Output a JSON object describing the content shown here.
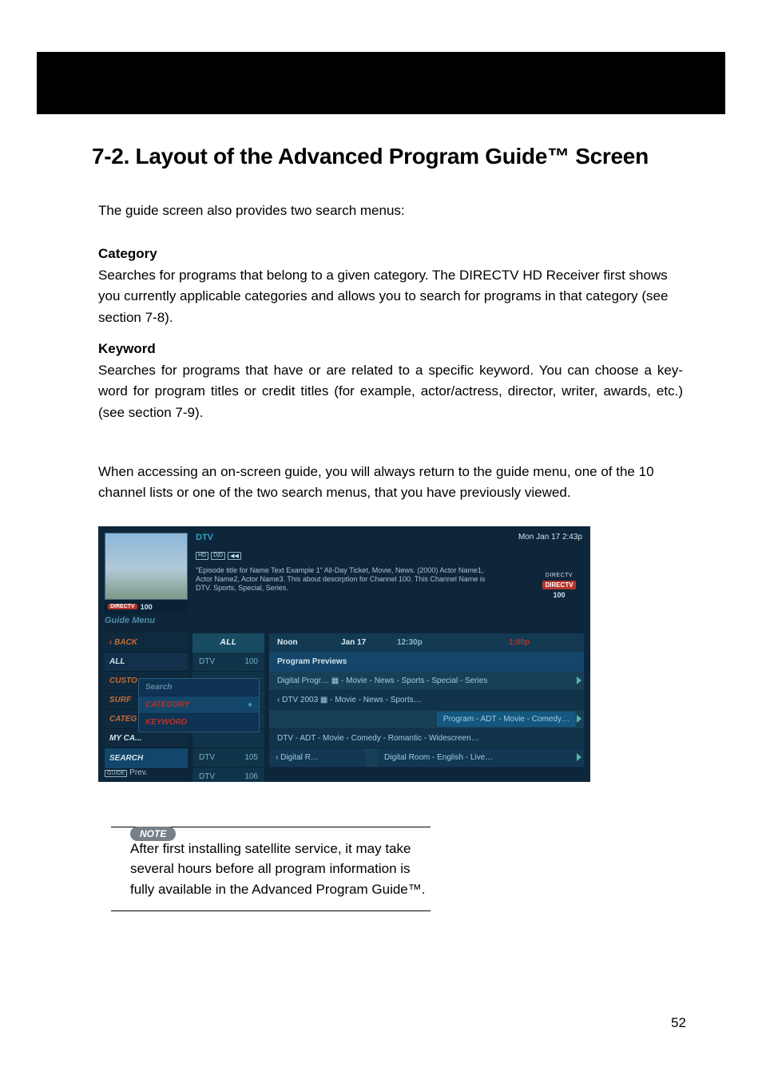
{
  "heading": "7-2. Layout of the Advanced Program Guide™ Screen",
  "intro": "The guide screen also provides two search menus:",
  "category": {
    "title": "Category",
    "body": "Searches for programs that belong to a given category. The DIRECTV HD Receiver first shows you currently applicable categories and allows you to search for programs in that category (see section 7-8)."
  },
  "keyword": {
    "title": "Keyword",
    "body": "Searches for programs that have or are related to a specific keyword. You can choose a key-word for program titles or credit titles (for example, actor/actress, director, writer, awards, etc.) (see section 7-9)."
  },
  "return_para": "When accessing an on-screen guide, you will always return to the guide menu, one of the 10 channel lists or one of the two search menus, that you have previously viewed.",
  "note": {
    "label": "NOTE",
    "body": "After first installing satellite service, it may take several hours before all program information is fully available in the Advanced Program Guide™."
  },
  "page_number": "52",
  "screenshot": {
    "channel_label": "DTV",
    "clock": "Mon Jan 17  2:43p",
    "icons": [
      "HD",
      "D|D",
      "◀◀"
    ],
    "info_text": "\"Episode title for Name Text Example 1\" All-Day Ticket, Movie, News. (2000) Actor Name1, Actor Name2, Actor Name3. This about descirption for Channel 100. This  Channel Name is DTV. Sports, Special, Series.",
    "logo_small": "DIRECTV",
    "logo_pill": "DIRECTV",
    "logo_num": "100",
    "mini_pill": "DIRECTV",
    "mini_num": "100",
    "guide_menu_label": "Guide Menu",
    "left_items": {
      "back": "‹ BACK",
      "all": "ALL",
      "custo": "CUSTO",
      "surf": "SURF",
      "categ": "CATEG",
      "myca": "MY CA...",
      "search": "SEARCH"
    },
    "popup": {
      "search": "Search",
      "category": "CATEGORY",
      "keyword": "KEYWORD",
      "dot": "●"
    },
    "mid_head": "ALL",
    "mid_rows": [
      {
        "a": "DTV",
        "b": "100"
      },
      {
        "a": "",
        "b": ""
      },
      {
        "a": "",
        "b": ""
      },
      {
        "a": "",
        "b": ""
      },
      {
        "a": "",
        "b": ""
      },
      {
        "a": "DTV",
        "b": "105"
      },
      {
        "a": "DTV",
        "b": "106"
      }
    ],
    "grid_head": {
      "c1": "Noon",
      "c2": "Jan 17",
      "c3": "12:30p",
      "c4": "1:00p"
    },
    "grid_title": "Program Previews",
    "grid_rows": [
      "Digital Progr…  ▦ - Movie - News - Sports - Special - Series",
      "‹ DTV 2003 ▦ - Movie - News - Sports…",
      "Program - ADT - Movie - Comedy…",
      "DTV - ADT - Movie - Comedy - Romantic - Widescreen…"
    ],
    "grid_last": {
      "a": "‹ Digital R…",
      "b": "Digital Room - English - Live…"
    },
    "prev_label": "Prev.",
    "prev_box": "GUIDE"
  }
}
